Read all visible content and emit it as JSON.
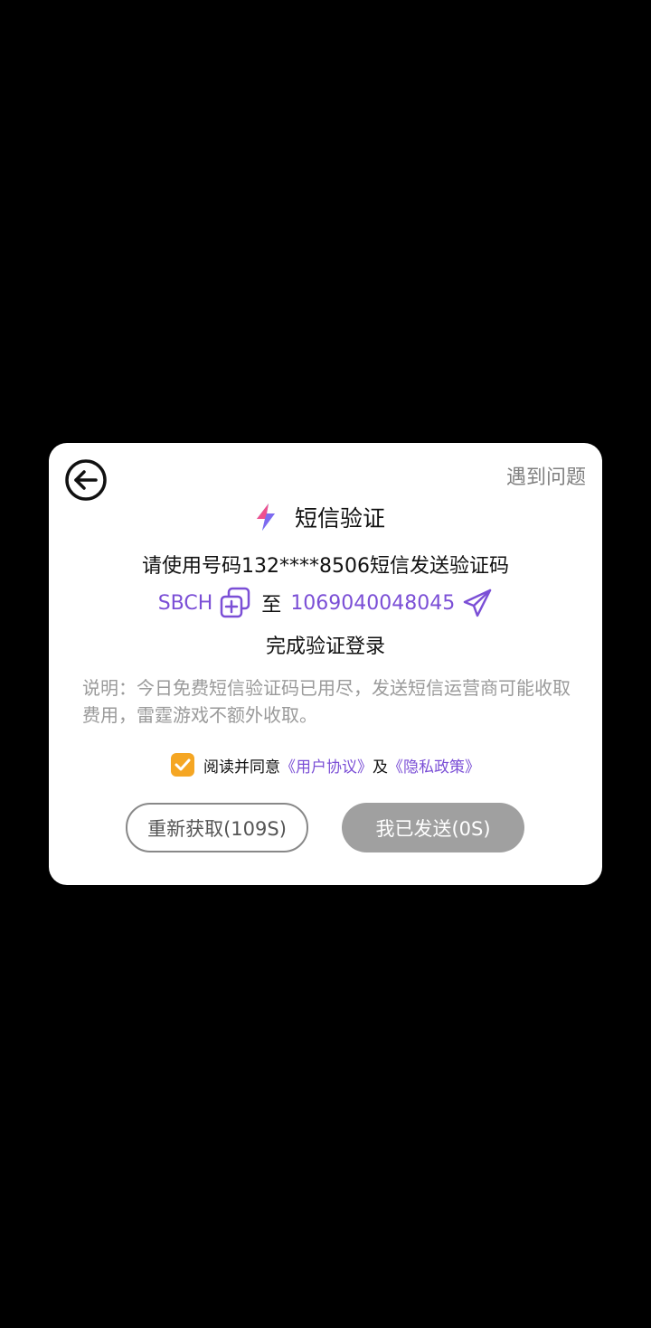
{
  "dialog": {
    "help_label": "遇到问题",
    "title": "短信验证",
    "instruction_line1": "请使用号码132****8506短信发送验证码",
    "sms_content": "SBCH",
    "to_label": "至",
    "sms_number": "1069040048045",
    "instruction_line3": "完成验证登录",
    "note": "说明：今日免费短信验证码已用尽，发送短信运营商可能收取费用，雷霆游戏不额外收取。",
    "agreement": {
      "prefix": "阅读并同意",
      "user_agreement": "《用户协议》",
      "and": "及",
      "privacy_policy": "《隐私政策》",
      "checked": true
    },
    "resend_button": "重新获取(109S)",
    "sent_button": "我已发送(0S)"
  },
  "colors": {
    "accent": "#7b4fd6",
    "checkbox": "#f5a623",
    "disabled_button": "#a0a0a0",
    "background": "#000000",
    "dialog": "#ffffff"
  },
  "icons": {
    "back": "back-arrow-circle-icon",
    "title": "lightning-bolt-icon",
    "copy": "copy-icon",
    "send": "paper-plane-icon",
    "checkbox": "checkmark-icon"
  }
}
